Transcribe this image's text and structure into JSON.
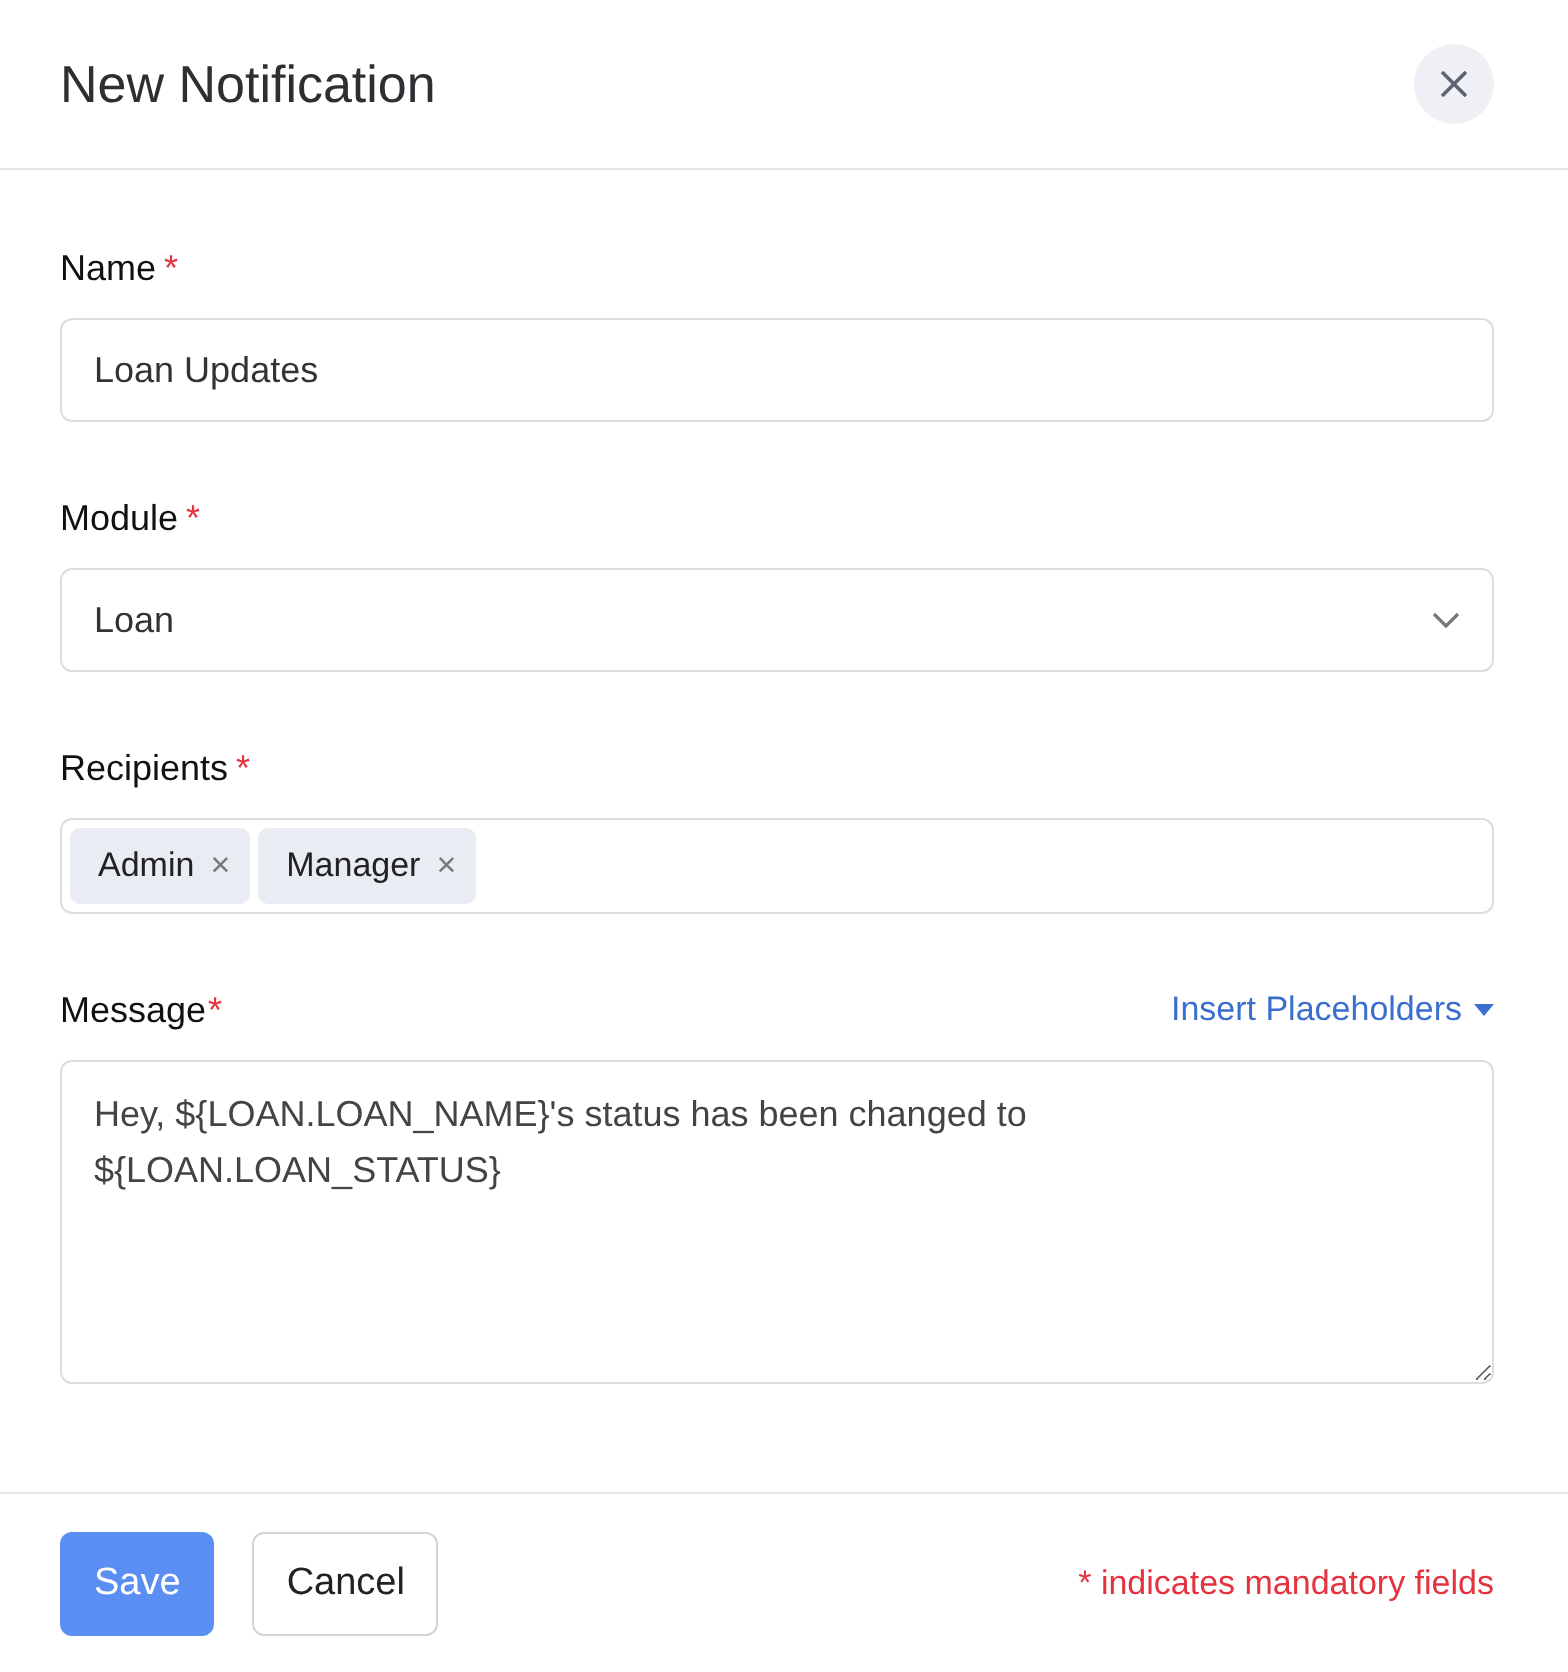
{
  "dialog": {
    "title": "New Notification"
  },
  "fields": [
    {
      "kind": "text",
      "label": "Name",
      "required_mark": "*",
      "value": "Loan Updates"
    },
    {
      "kind": "select",
      "label": "Module",
      "required_mark": "*",
      "value": "Loan"
    },
    {
      "kind": "tags",
      "label": "Recipients",
      "required_mark": "*",
      "tags": [
        {
          "label": "Admin",
          "remove": "×"
        },
        {
          "label": "Manager",
          "remove": "×"
        }
      ]
    },
    {
      "kind": "textarea",
      "label": "Message",
      "required_mark": "*",
      "action": "Insert Placeholders",
      "value": "Hey, ${LOAN.LOAN_NAME}'s status has been changed to\n${LOAN.LOAN_STATUS}"
    }
  ],
  "footer": {
    "buttons": [
      {
        "label": "Save",
        "kind": "primary"
      },
      {
        "label": "Cancel",
        "kind": "secondary"
      }
    ],
    "note": "* indicates mandatory fields"
  }
}
